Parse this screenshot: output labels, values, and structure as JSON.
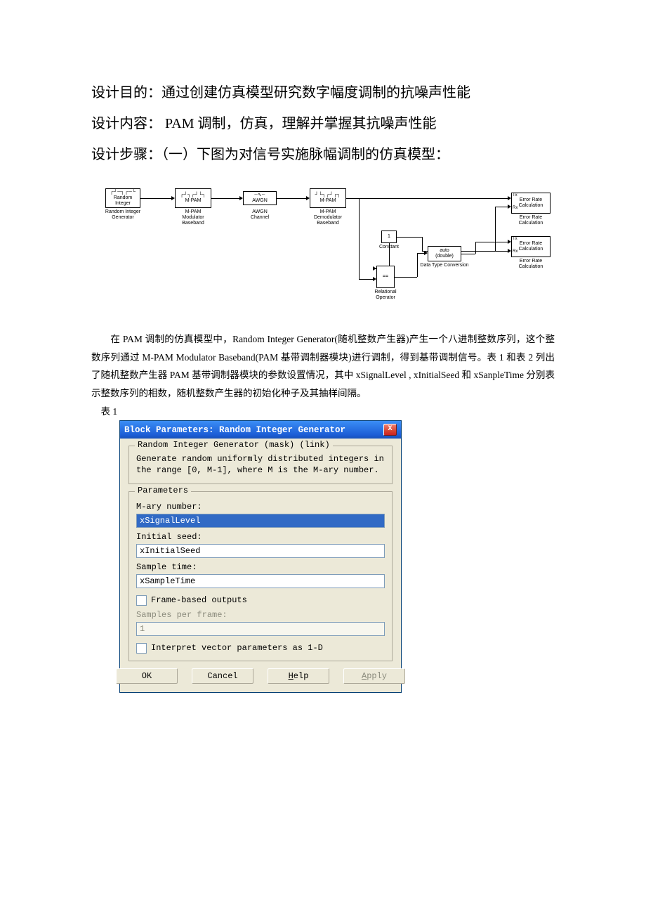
{
  "headings": {
    "purpose": "设计目的：通过创建仿真模型研究数字幅度调制的抗噪声性能",
    "content": "设计内容： PAM 调制，仿真，理解并掌握其抗噪声性能",
    "steps": "设计步骤：（一）下图为对信号实施脉幅调制的仿真模型："
  },
  "diagram": {
    "blocks": {
      "rig_top": "Random",
      "rig_top2": "Integer",
      "rig_label1": "Random Integer",
      "rig_label2": "Generator",
      "mpam_mod": "M-PAM",
      "mpam_mod_label1": "M-PAM",
      "mpam_mod_label2": "Modulator",
      "mpam_mod_label3": "Baseband",
      "awgn": "AWGN",
      "awgn_label1": "AWGN",
      "awgn_label2": "Channel",
      "mpam_demod": "M-PAM",
      "mpam_demod_label1": "M-PAM",
      "mpam_demod_label2": "Demodulator",
      "mpam_demod_label3": "Baseband",
      "constant_val": "1",
      "constant_label": "Constant",
      "relop": "==",
      "relop_label1": "Relational",
      "relop_label2": "Operator",
      "dtc1": "auto",
      "dtc2": "(double)",
      "dtc_label": "Data Type Conversion",
      "err_tx": "Tx",
      "err_rx": "Rx",
      "err_label1": "Error Rate",
      "err_label2": "Calculation",
      "err_label3": "Error Rate",
      "err_label4": "Calculation"
    }
  },
  "body_text": "在 PAM 调制的仿真模型中，Random Integer Generator(随机整数产生器)产生一个八进制整数序列，这个整数序列通过 M-PAM Modulator Baseband(PAM 基带调制器模块)进行调制，得到基带调制信号。表 1 和表 2  列出了随机整数产生器 PAM 基带调制器模块的参数设置情况，其中 xSignalLevel , xInitialSeed  和  xSanpleTime 分别表示整数序列的相数，随机整数产生器的初始化种子及其抽样间隔。",
  "table_caption": "表 1",
  "dialog": {
    "title": "Block Parameters: Random Integer Generator",
    "close": "X",
    "group1_legend": "Random Integer Generator (mask) (link)",
    "group1_desc": "Generate random uniformly distributed integers in the range [0, M-1], where M is the M-ary number.",
    "group2_legend": "Parameters",
    "labels": {
      "mary": "M-ary number:",
      "seed": "Initial seed:",
      "sample": "Sample time:",
      "samples_per_frame": "Samples per frame:"
    },
    "values": {
      "mary": "xSignalLevel",
      "seed": "xInitialSeed",
      "sample": "xSampleTime",
      "samples_per_frame": "1"
    },
    "checks": {
      "frame": "Frame-based outputs",
      "vec1d": "Interpret vector parameters as 1-D"
    },
    "buttons": {
      "ok": "OK",
      "cancel": "Cancel",
      "help_pre": "H",
      "help_rest": "elp",
      "apply_pre": "A",
      "apply_rest": "pply"
    }
  }
}
